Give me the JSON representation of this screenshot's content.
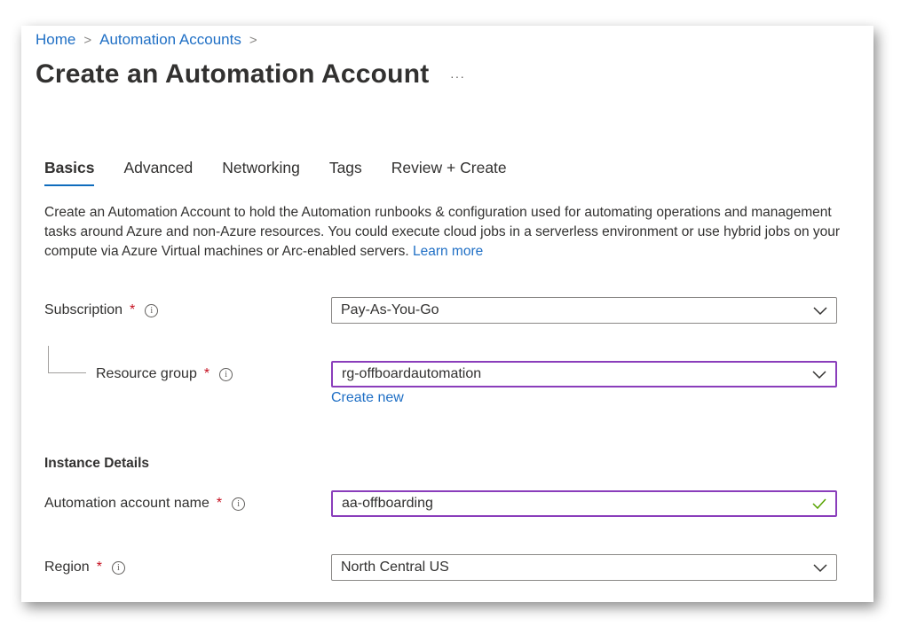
{
  "breadcrumb": {
    "home": "Home",
    "automation_accounts": "Automation Accounts",
    "separator": ">"
  },
  "page": {
    "title": "Create an Automation Account",
    "more": "···"
  },
  "tabs": [
    {
      "label": "Basics",
      "active": true
    },
    {
      "label": "Advanced",
      "active": false
    },
    {
      "label": "Networking",
      "active": false
    },
    {
      "label": "Tags",
      "active": false
    },
    {
      "label": "Review + Create",
      "active": false
    }
  ],
  "description": {
    "text": "Create an Automation Account to hold the Automation runbooks & configuration used for automating operations and management tasks around Azure and non-Azure resources. You could execute cloud jobs in a serverless environment or use hybrid jobs on your compute via Azure Virtual machines or Arc-enabled servers.",
    "link": "Learn more"
  },
  "form": {
    "required_mark": "*",
    "info_icon": "i",
    "subscription": {
      "label": "Subscription",
      "value": "Pay-As-You-Go"
    },
    "resource_group": {
      "label": "Resource group",
      "value": "rg-offboardautomation",
      "create_new": "Create new"
    },
    "instance_details_heading": "Instance Details",
    "account_name": {
      "label": "Automation account name",
      "value": "aa-offboarding",
      "valid": true
    },
    "region": {
      "label": "Region",
      "value": "North Central US"
    }
  },
  "colors": {
    "link": "#1f6fc5",
    "active_tab_underline": "#0f6cbd",
    "required": "#c50f1f",
    "focus_border": "#8a3dbb",
    "valid_check": "#57a300"
  },
  "icons": {
    "dropdown": "chevron-down-icon",
    "info": "info-icon",
    "valid": "checkmark-icon",
    "more": "more-icon"
  }
}
